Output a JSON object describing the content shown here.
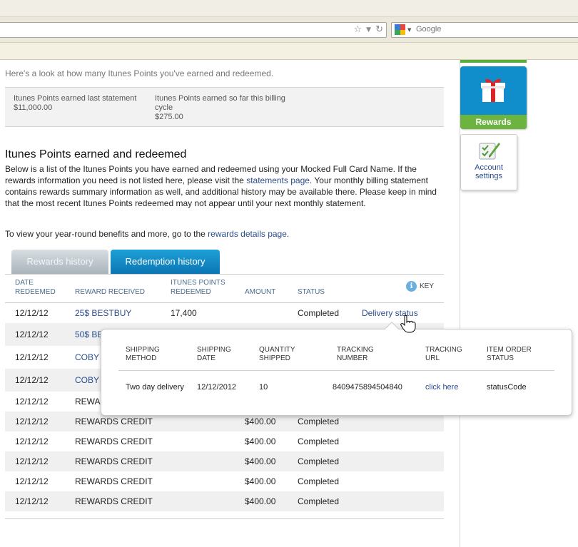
{
  "browser": {
    "search_placeholder": "Google",
    "search_engine_icon": "google-icon",
    "url_icons": [
      "star-icon",
      "dropdown-arrow-icon",
      "reload-icon"
    ]
  },
  "intro": "Here's a look at how many Itunes Points you've earned and redeemed.",
  "summary": {
    "last_statement_label": "Itunes Points earned last statement",
    "last_statement_value": "$11,000.00",
    "billing_cycle_label": "Itunes Points earned so far this billing cycle",
    "billing_cycle_value": "$275.00"
  },
  "section": {
    "title": "Itunes Points earned and redeemed",
    "desc_part1": "Below is a list of the Itunes Points you have earned and redeemed using your Mocked Full Card Name. If the rewards information you need is not listed here, please visit the ",
    "statements_link": "statements page",
    "desc_part2": ". Your monthly billing statement contains rewards summary information as well, and additional history may be available there. Please keep in mind that the most recent Itunes Points redeemed may not appear until your next monthly statement.",
    "view_part1": "To view your year-round benefits and more, go to the ",
    "rewards_details_link": "rewards details page",
    "view_part2": "."
  },
  "tabs": {
    "rewards_history": "Rewards history",
    "redemption_history": "Redemption history"
  },
  "table": {
    "headers": {
      "date": "DATE\nREDEEMED",
      "reward": "REWARD RECEIVED",
      "points": "ITUNES POINTS\nREDEEMED",
      "amount": "AMOUNT",
      "status": "STATUS",
      "key": "KEY"
    },
    "rows": [
      {
        "date": "12/12/12",
        "reward": "25$ BESTBUY",
        "points": "17,400",
        "amount": "",
        "status": "Completed",
        "action": "Delivery status"
      },
      {
        "date": "12/12/12",
        "reward": "50$ BE",
        "points": "",
        "amount": "",
        "status": "",
        "action": ""
      },
      {
        "date": "12/12/12",
        "reward": "COBY",
        "points": "",
        "amount": "",
        "status": "",
        "action": ""
      },
      {
        "date": "12/12/12",
        "reward": "COBY",
        "points": "",
        "amount": "",
        "status": "",
        "action": ""
      },
      {
        "date": "12/12/12",
        "reward": "REWAR",
        "points": "",
        "amount": "",
        "status": "",
        "action": ""
      },
      {
        "date": "12/12/12",
        "reward": "REWARDS CREDIT",
        "points": "",
        "amount": "$400.00",
        "status": "Completed",
        "action": ""
      },
      {
        "date": "12/12/12",
        "reward": "REWARDS CREDIT",
        "points": "",
        "amount": "$400.00",
        "status": "Completed",
        "action": ""
      },
      {
        "date": "12/12/12",
        "reward": "REWARDS CREDIT",
        "points": "",
        "amount": "$400.00",
        "status": "Completed",
        "action": ""
      },
      {
        "date": "12/12/12",
        "reward": "REWARDS CREDIT",
        "points": "",
        "amount": "$400.00",
        "status": "Completed",
        "action": ""
      },
      {
        "date": "12/12/12",
        "reward": "REWARDS CREDIT",
        "points": "",
        "amount": "$400.00",
        "status": "Completed",
        "action": ""
      }
    ]
  },
  "popover": {
    "headers": {
      "shipping_method": "SHIPPING\nMETHOD",
      "shipping_date": "SHIPPING\nDATE",
      "quantity_shipped": "QUANTITY\nSHIPPED",
      "tracking_number": "TRACKING\nNUMBER",
      "tracking_url": "TRACKING\nURL",
      "item_order_status": "ITEM ORDER\nSTATUS"
    },
    "row": {
      "shipping_method": "Two day delivery",
      "shipping_date": "12/12/2012",
      "quantity_shipped": "10",
      "tracking_number": "8409475894504840",
      "tracking_url": "click here",
      "item_order_status": "statusCode"
    }
  },
  "sidebar": {
    "rewards_label": "Rewards",
    "account_settings_label": "Account settings"
  },
  "colors": {
    "link": "#2b4d8c",
    "tab_active": "#0b76b4",
    "rewards_tile": "#0f8ecb",
    "rewards_label_bg": "#6cb33f"
  }
}
